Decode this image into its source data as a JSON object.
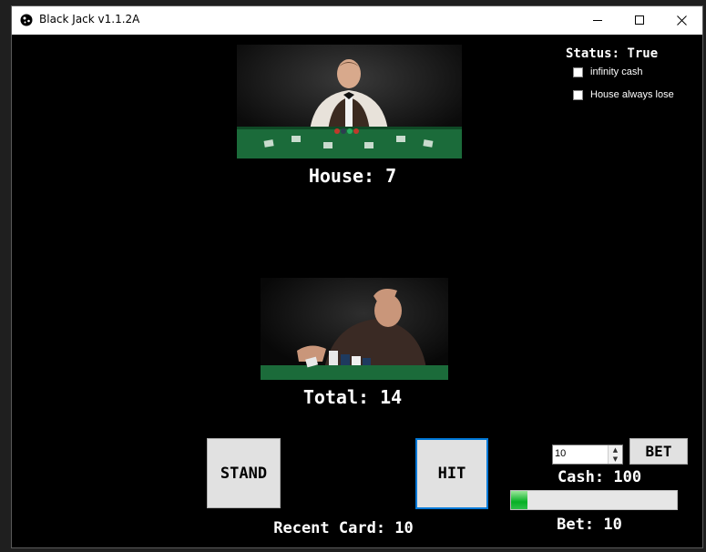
{
  "window": {
    "title": "Black Jack v1.1.2A"
  },
  "status": {
    "text": "Status: True"
  },
  "options": [
    {
      "label": "infinity cash",
      "checked": false
    },
    {
      "label": "House always lose",
      "checked": false
    }
  ],
  "house": {
    "score_text": "House: 7"
  },
  "player": {
    "total_text": "Total: 14"
  },
  "actions": {
    "stand_label": "STAND",
    "hit_label": "HIT",
    "bet_label": "BET"
  },
  "bet_input": {
    "value": "10"
  },
  "cash": {
    "text": "Cash: 100",
    "progress": 0.1
  },
  "bet": {
    "text": "Bet: 10"
  },
  "recent": {
    "text": "Recent Card: 10"
  },
  "colors": {
    "accent": "#0078d7",
    "progress": "#06b025",
    "felt": "#1b6b3a"
  }
}
